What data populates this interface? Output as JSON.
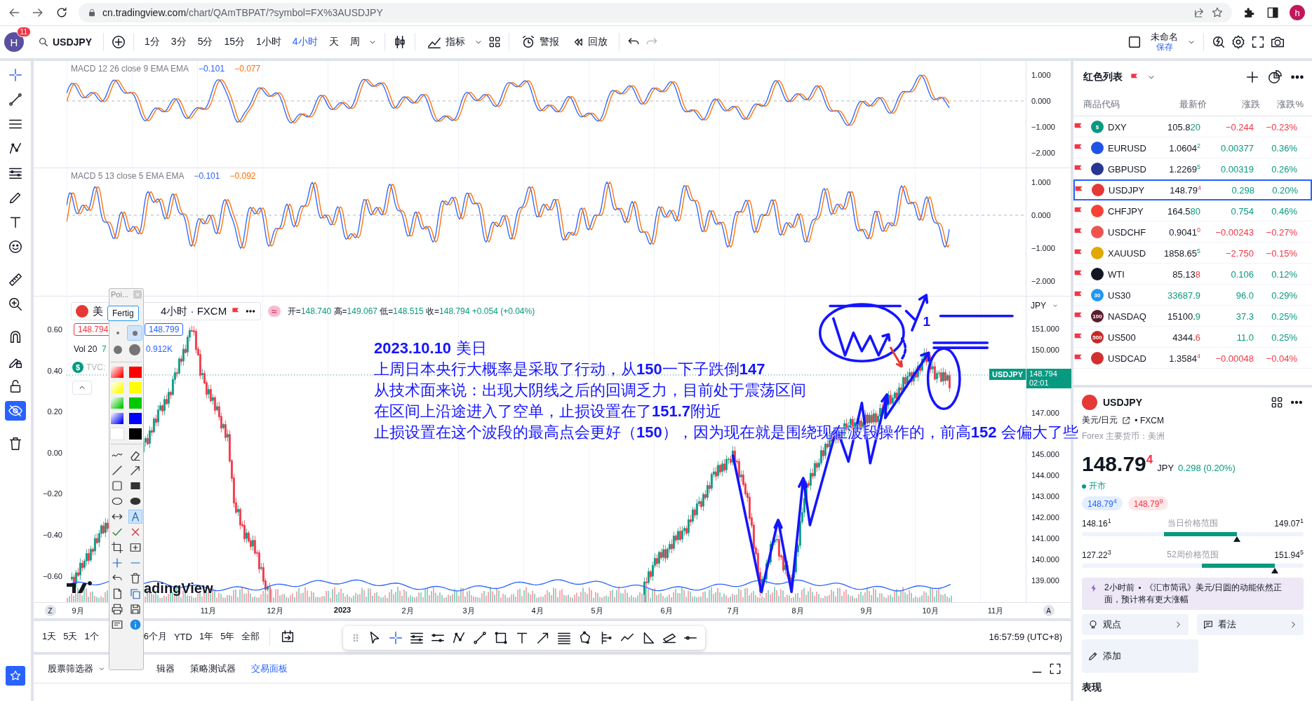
{
  "browser": {
    "host": "cn.tradingview.com",
    "path": "/chart/QAmTBPAT/?symbol=FX%3AUSDJPY",
    "profile": "h"
  },
  "toolbar": {
    "avatar": "H",
    "badge": "11",
    "symbol": "USDJPY",
    "intervals": [
      {
        "label": "1分",
        "selected": false
      },
      {
        "label": "3分",
        "selected": false
      },
      {
        "label": "5分",
        "selected": false
      },
      {
        "label": "15分",
        "selected": false
      },
      {
        "label": "1小时",
        "selected": false
      },
      {
        "label": "4小时",
        "selected": true
      },
      {
        "label": "天",
        "selected": false
      },
      {
        "label": "周",
        "selected": false
      }
    ],
    "indicators": "指标",
    "alerts": "警报",
    "replay": "回放",
    "layout_name": "未命名",
    "save": "保存"
  },
  "panes": [
    {
      "legend": "MACD 12 26 close 9 EMA EMA",
      "values": [
        {
          "text": "−0.101",
          "color": "#2962ff"
        },
        {
          "text": "−0.077",
          "color": "#ff6d00"
        }
      ],
      "axis": [
        "1.000",
        "0.000",
        "−1.000",
        "−2.000"
      ]
    },
    {
      "legend": "MACD 5 13 close 5 EMA EMA",
      "values": [
        {
          "text": "−0.101",
          "color": "#2962ff"
        },
        {
          "text": "−0.092",
          "color": "#ff6d00"
        }
      ],
      "axis": [
        "1.000",
        "0.000",
        "−1.000",
        "−2.000"
      ]
    }
  ],
  "main": {
    "symbol": "美",
    "interval": "4小时 · FXCM",
    "wave_badge": "≈",
    "ohlc": [
      {
        "label": "开=",
        "value": "148.740"
      },
      {
        "label": "高=",
        "value": "149.067"
      },
      {
        "label": "低=",
        "value": "148.515"
      },
      {
        "label": "收=",
        "value": "148.794"
      }
    ],
    "change": "+0.054 (+0.04%)",
    "bid": "148.794",
    "ask": "148.799",
    "volume_label": "Vol 20",
    "volume_value": "7",
    "volume_ma": "0.912K",
    "source_icon": "$",
    "source": "TVC:",
    "left_axis": [
      "0.60",
      "0.40",
      "0.20",
      "0.00",
      "−0.20",
      "−0.40",
      "−0.60"
    ],
    "right_axis": [
      "151.000",
      "150.000",
      "147.000",
      "145.000",
      "144.000",
      "143.000",
      "142.000",
      "141.000",
      "140.000",
      "139.000"
    ],
    "currency": "JPY",
    "price_tag": {
      "symbol": "USDJPY",
      "price": "148.794",
      "countdown": "02:01"
    },
    "logo": "adingView",
    "annotation": {
      "lines": [
        "**2023.10.10** 美日",
        "上周日本央行大概率是采取了行动，从**150**一下子跌倒**147**",
        "从技术面来说：出现大阴线之后的回调乏力，目前处于震荡区间",
        "在区间上沿途进入了空单，止损设置在了**151.7**附近",
        "止损设置在这个波段的最高点会更好（**150**），因为现在就是围绕现在波段操作的，前高**152** 会偏大了些"
      ],
      "wave_label": "1"
    }
  },
  "time_axis": {
    "left_button": "Z",
    "right_button": "A",
    "labels": [
      "9月",
      "11月",
      "12月",
      "2023",
      "2月",
      "3月",
      "4月",
      "5月",
      "6月",
      "7月",
      "8月",
      "9月",
      "10月",
      "11月"
    ]
  },
  "ranges": [
    "1天",
    "5天",
    "1个",
    "6个月",
    "YTD",
    "1年",
    "5年",
    "全部"
  ],
  "clock": "16:57:59 (UTC+8)",
  "bottom_tabs": [
    {
      "label": "股票筛选器",
      "selected": false
    },
    {
      "label": "辑器",
      "selected": false
    },
    {
      "label": "策略测试器",
      "selected": false
    },
    {
      "label": "交易面板",
      "selected": true
    }
  ],
  "popup": {
    "title": "Poi...",
    "close": "×",
    "done": "Fertig",
    "sizes": [
      {
        "selected": false
      },
      {
        "selected": true
      },
      {
        "selected": false
      },
      {
        "selected": false
      }
    ],
    "swatches": [
      {
        "kind": "gradient",
        "color": "#ff0000"
      },
      {
        "kind": "solid",
        "color": "#ff0000"
      },
      {
        "kind": "gradient",
        "color": "#ffff00"
      },
      {
        "kind": "solid",
        "color": "#ffff00"
      },
      {
        "kind": "gradient",
        "color": "#00c800"
      },
      {
        "kind": "solid",
        "color": "#00c800"
      },
      {
        "kind": "gradient",
        "color": "#0000ff"
      },
      {
        "kind": "solid",
        "color": "#0000ff"
      },
      {
        "kind": "solid",
        "color": "#ffffff"
      },
      {
        "kind": "solid",
        "color": "#000000"
      }
    ]
  },
  "watchlist": {
    "title": "红色列表",
    "columns": [
      "商品代码",
      "最新价",
      "涨跌",
      "涨跌%"
    ],
    "rows": [
      {
        "symbol": "DXY",
        "color": "#089981",
        "icon_text": "$",
        "price": "105.8",
        "tail": "20",
        "raised": false,
        "price_up": true,
        "change": "−0.244",
        "change_pct": "−0.23%",
        "change_up": false,
        "selected": false
      },
      {
        "symbol": "EURUSD",
        "color": "#1e53e5",
        "price": "1.0604",
        "tail": "2",
        "raised": true,
        "price_up": true,
        "change": "0.00377",
        "change_pct": "0.36%",
        "change_up": true,
        "selected": false
      },
      {
        "symbol": "GBPUSD",
        "color": "#283593",
        "price": "1.2269",
        "tail": "5",
        "raised": true,
        "price_up": true,
        "change": "0.00319",
        "change_pct": "0.26%",
        "change_up": true,
        "selected": false
      },
      {
        "symbol": "USDJPY",
        "color": "#e53935",
        "price": "148.79",
        "tail": "4",
        "raised": true,
        "price_up": false,
        "change": "0.298",
        "change_pct": "0.20%",
        "change_up": true,
        "selected": true
      },
      {
        "symbol": "CHFJPY",
        "color": "#f44336",
        "price": "164.5",
        "tail": "80",
        "raised": false,
        "price_up": true,
        "change": "0.754",
        "change_pct": "0.46%",
        "change_up": true,
        "selected": false
      },
      {
        "symbol": "USDCHF",
        "color": "#ef5350",
        "price": "0.9041",
        "tail": "0",
        "raised": true,
        "price_up": false,
        "change": "−0.00243",
        "change_pct": "−0.27%",
        "change_up": false,
        "selected": false
      },
      {
        "symbol": "XAUUSD",
        "color": "#e0a800",
        "price": "1858.65",
        "tail": "5",
        "raised": true,
        "price_up": true,
        "change": "−2.750",
        "change_pct": "−0.15%",
        "change_up": false,
        "selected": false
      },
      {
        "symbol": "WTI",
        "color": "#131722",
        "price": "85.13",
        "tail": "8",
        "raised": false,
        "price_up": false,
        "change": "0.106",
        "change_pct": "0.12%",
        "change_up": true,
        "selected": false
      },
      {
        "symbol": "US30",
        "color": "#2196f3",
        "icon_text": "30",
        "tail": "33687.9",
        "raised": false,
        "price_up": true,
        "change": "96.0",
        "change_pct": "0.29%",
        "change_up": true,
        "selected": false
      },
      {
        "symbol": "NASDAQ",
        "color": "#5d1b2b",
        "icon_text": "100",
        "price": "15100.",
        "tail": "9",
        "raised": false,
        "price_up": true,
        "change": "37.3",
        "change_pct": "0.25%",
        "change_up": true,
        "selected": false
      },
      {
        "symbol": "US500",
        "color": "#c62828",
        "icon_text": "500",
        "price": "4344.",
        "tail": "6",
        "raised": false,
        "price_up": false,
        "change": "11.0",
        "change_pct": "0.25%",
        "change_up": true,
        "selected": false
      },
      {
        "symbol": "USDCAD",
        "color": "#d32f2f",
        "price": "1.3584",
        "tail": "4",
        "raised": true,
        "price_up": false,
        "change": "−0.00048",
        "change_pct": "−0.04%",
        "change_up": false,
        "selected": false
      }
    ]
  },
  "detail": {
    "symbol": "USDJPY",
    "name": "美元/日元",
    "exchange": "• FXCM",
    "category": "Forex 主要货币：美洲",
    "price": "148.79",
    "tail": "4",
    "price_up": false,
    "currency": "JPY",
    "change": "0.298 (0.20%)",
    "status": "开市",
    "bid": {
      "price": "148.79",
      "tail": "4"
    },
    "ask": {
      "price": "148.79",
      "tail": "9"
    },
    "ranges": [
      {
        "low": "148.16",
        "low_tail": "1",
        "label": "当日价格范围",
        "high": "149.07",
        "high_tail": "1",
        "level": 0.7
      },
      {
        "low": "127.22",
        "low_tail": "3",
        "label": "52周价格范围",
        "high": "151.94",
        "high_tail": "5",
        "level": 0.87
      }
    ],
    "news": {
      "time": "2小时前",
      "text": "《汇市简讯》美元/日圆的动能依然正面，预计将有更大涨幅"
    },
    "buttons": [
      "观点",
      "看法"
    ],
    "add": "添加",
    "section": "表现"
  }
}
